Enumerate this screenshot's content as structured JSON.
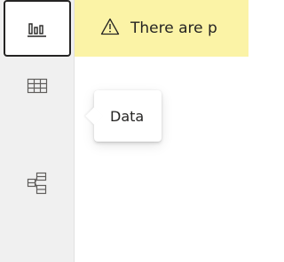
{
  "viewbar": {
    "items": [
      {
        "id": "report",
        "icon": "bar-chart-icon",
        "active": true
      },
      {
        "id": "data",
        "icon": "table-grid-icon",
        "active": false
      },
      {
        "id": "model",
        "icon": "model-view-icon",
        "active": false
      }
    ]
  },
  "banner": {
    "icon": "warning-triangle-icon",
    "text": "There are p",
    "color": "#fbf3a6"
  },
  "tooltip": {
    "text": "Data"
  }
}
